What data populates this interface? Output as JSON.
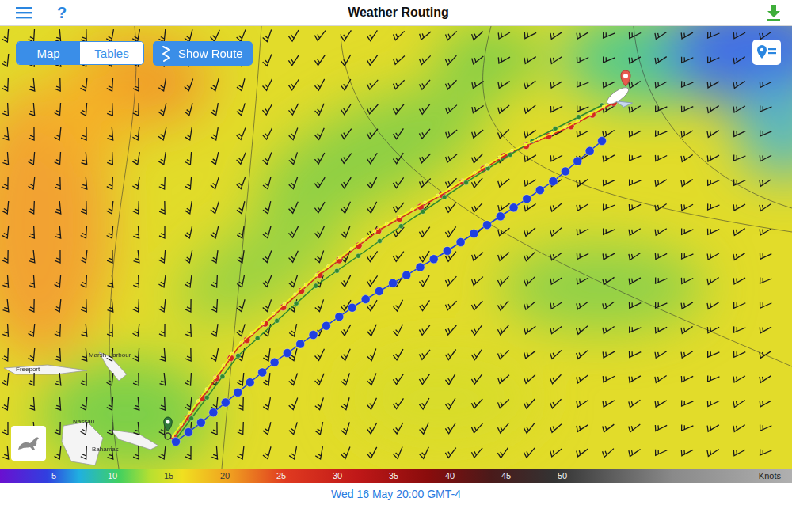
{
  "header": {
    "title": "Weather Routing",
    "help": "?"
  },
  "view_tabs": [
    {
      "label": "Map",
      "selected": true
    },
    {
      "label": "Tables",
      "selected": false
    }
  ],
  "show_route": {
    "label": "Show Route"
  },
  "places": [
    {
      "label": "Freeport"
    },
    {
      "label": "Marsh Harbour"
    },
    {
      "label": "Nassau"
    },
    {
      "label": "Bahamas"
    }
  ],
  "routes": [
    {
      "color": "#d42a1c"
    },
    {
      "color": "#2f8a2f"
    },
    {
      "color": "#1f3fe0"
    },
    {
      "color": "#f4f21c"
    }
  ],
  "legend": {
    "ticks": [
      "5",
      "10",
      "15",
      "20",
      "25",
      "30",
      "35",
      "40",
      "45",
      "50"
    ],
    "unit": "Knots"
  },
  "time": "Wed 16 May 20:00 GMT-4"
}
